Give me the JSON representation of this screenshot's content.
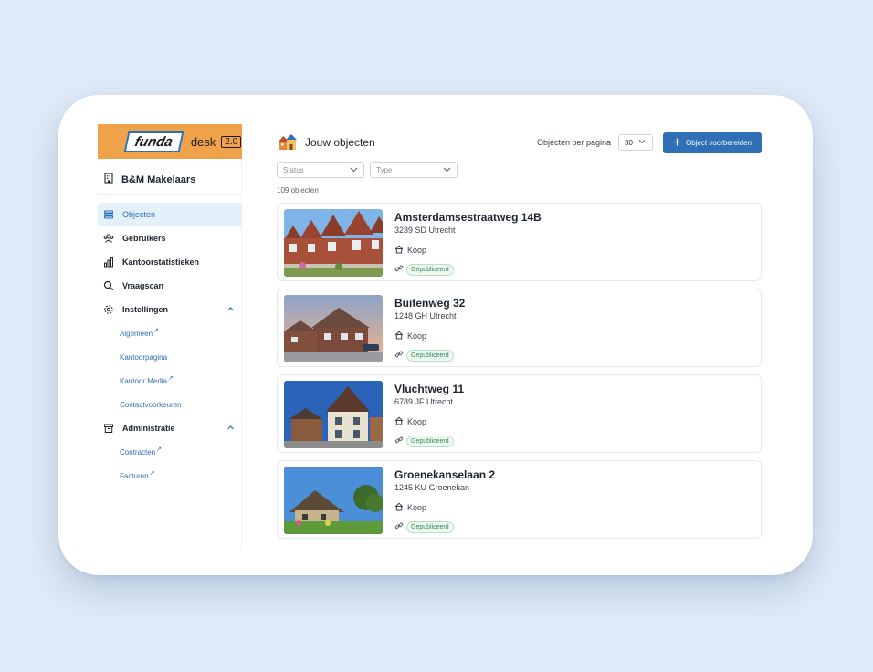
{
  "brand": {
    "logo": "funda",
    "product": "desk",
    "version": "2.0",
    "color": "#f0a24a"
  },
  "company": "B&M Makelaars",
  "nav": {
    "objecten": "Objecten",
    "gebruikers": "Gebruikers",
    "kantoorstatistieken": "Kantoorstatistieken",
    "vraagscan": "Vraagscan",
    "instellingen": "Instellingen",
    "algemeen": "Algemeen",
    "kantoorpagina": "Kantoorpagina",
    "kantoormedia": "Kantoor Media",
    "contactvoorkeuren": "Contactvoorkeuren",
    "administratie": "Administratie",
    "contracten": "Contracten",
    "facturen": "Facturen"
  },
  "header": {
    "title": "Jouw objecten",
    "perpage_label": "Objecten per pagina",
    "perpage_value": "30",
    "button": "Object voorbereiden"
  },
  "filters": {
    "status": "Status",
    "type": "Type"
  },
  "count": "109 objecten",
  "objects": [
    {
      "address": "Amsterdamsestraatweg 14B",
      "zip": "3239 SD Utrecht",
      "type": "Koop",
      "status": "Gepubliceerd"
    },
    {
      "address": "Buitenweg 32",
      "zip": "1248 GH Utrecht",
      "type": "Koop",
      "status": "Gepubliceerd"
    },
    {
      "address": "Vluchtweg 11",
      "zip": "6789 JF Utrecht",
      "type": "Koop",
      "status": "Gepubliceerd"
    },
    {
      "address": "Groenekanselaan 2",
      "zip": "1245 KU Groenekan",
      "type": "Koop",
      "status": "Gepubliceerd"
    }
  ],
  "colors": {
    "accent": "#2f6fb5",
    "active_bg": "#e4f1fb",
    "badge": "#2e8b57"
  }
}
